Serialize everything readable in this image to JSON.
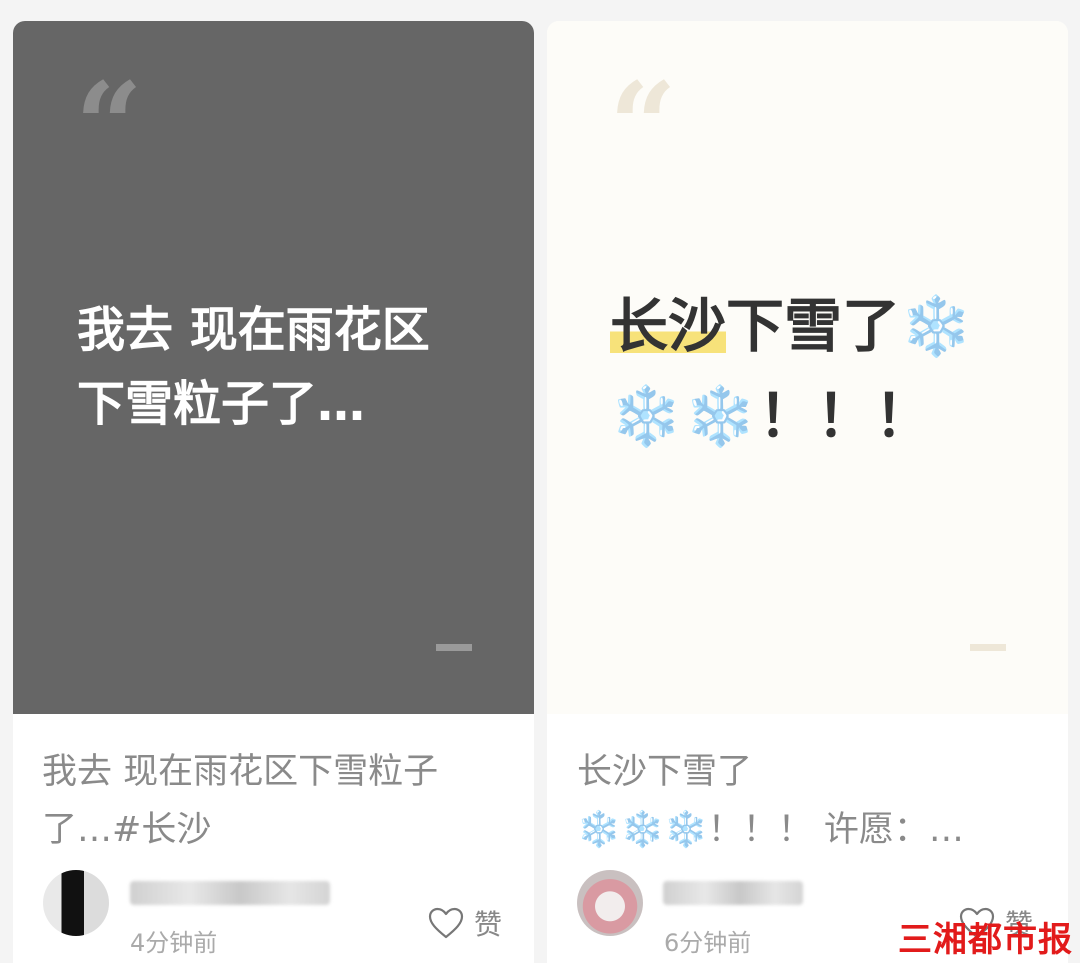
{
  "posts": [
    {
      "cover_text_lines": [
        "我去 现在雨花区",
        "下雪粒子了…"
      ],
      "title_lines": [
        "我去 现在雨花区下雪粒子",
        "了…#长沙"
      ],
      "time": "4分钟前",
      "like_label": "赞"
    },
    {
      "cover_text": {
        "highlighted": "长沙",
        "rest": "下雪了",
        "line1_emoji": "❄️",
        "line2_emoji": "❄️❄️",
        "line2_punct": "！！！"
      },
      "title_lines": [
        "长沙下雪了",
        "❄️❄️❄️！！！ 许愿：…"
      ],
      "time": "6分钟前",
      "like_label": "赞"
    }
  ],
  "quote_mark": "“",
  "watermark": "三湘都市报",
  "colors": {
    "left_cover_bg": "#666666",
    "right_cover_bg": "#fdfcf8",
    "highlight": "#f7e27a",
    "watermark": "#e21b1b"
  },
  "icons": [
    "quote-icon",
    "heart-icon",
    "snowflake-icon"
  ]
}
